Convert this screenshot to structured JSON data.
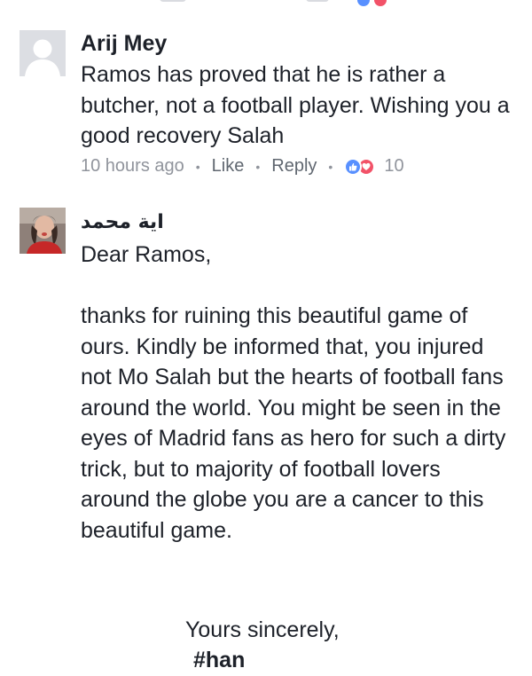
{
  "comments": [
    {
      "author": "Arij Mey",
      "avatar": "default-avatar-icon",
      "text": "Ramos has proved that he is rather a butcher, not a football player. Wishing you a good recovery Salah",
      "time": "10 hours ago",
      "like_label": "Like",
      "reply_label": "Reply",
      "reaction_count": "10",
      "reactions": [
        "like-reaction-icon",
        "love-reaction-icon"
      ]
    },
    {
      "author": "اية محمد",
      "avatar": "profile-photo",
      "greeting": "Dear Ramos,",
      "text": "thanks for ruining this beautiful game of ours. Kindly be informed that, you injured not Mo Salah but the hearts of football fans around the world. You might be seen in the eyes of Madrid fans as hero for such a dirty trick, but to majority of football lovers around the globe you are a cancer to this beautiful game.",
      "signoff": "Yours sincerely,",
      "hashtag": "#han"
    }
  ],
  "colors": {
    "text": "#1d2129",
    "meta": "#90949c",
    "like_blue": "#5890ff",
    "love_red": "#f25268",
    "avatar_placeholder": "#dcdee3"
  }
}
